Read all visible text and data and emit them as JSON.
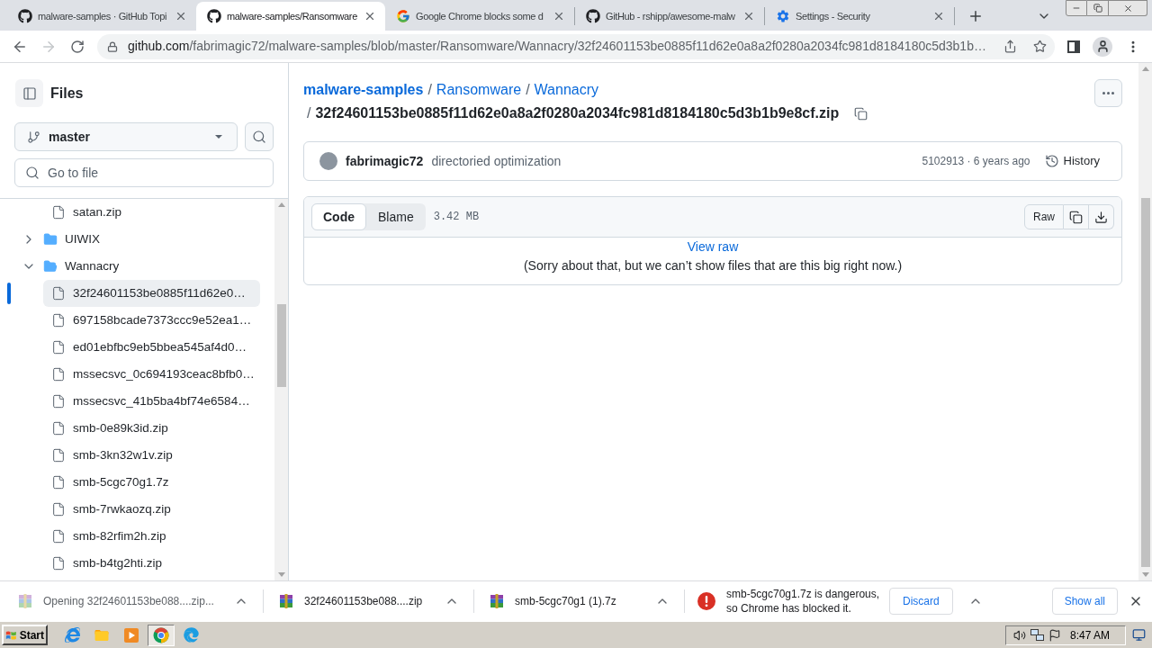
{
  "browser": {
    "tabs": [
      {
        "kind": "github",
        "title": "malware-samples · GitHub Topi",
        "selected": false
      },
      {
        "kind": "github",
        "title": "malware-samples/Ransomware",
        "selected": true
      },
      {
        "kind": "google",
        "title": "Google Chrome blocks some d",
        "selected": false
      },
      {
        "kind": "github",
        "title": "GitHub - rshipp/awesome-malw",
        "selected": false
      },
      {
        "kind": "settings",
        "title": "Settings - Security",
        "selected": false
      }
    ],
    "nav_buttons": [
      {
        "kind": "back",
        "disabled": false
      },
      {
        "kind": "forward",
        "disabled": true
      },
      {
        "kind": "reload",
        "disabled": false
      }
    ],
    "address_bar": {
      "host": "github.com",
      "path": "/fabrimagic72/malware-samples/blob/master/Ransomware/Wannacry/32f24601153be0885f11d62e0a8a2f0280a2034fc981d8184180c5d3b1b…"
    }
  },
  "sidebar": {
    "title": "Files",
    "branch": "master",
    "file_search": {
      "placeholder": "Go to file"
    },
    "tree": [
      {
        "kind": "continuation",
        "children": [
          {
            "kind": "file",
            "name": "satan.zip",
            "selected": false
          }
        ]
      },
      {
        "kind": "folder",
        "name": "UIWIX",
        "expanded": false,
        "selected": false
      },
      {
        "kind": "folder",
        "name": "Wannacry",
        "expanded": true,
        "selected": false,
        "children": [
          {
            "kind": "file",
            "name": "32f24601153be0885f11d62e0…",
            "selected": true
          },
          {
            "kind": "file",
            "name": "697158bcade7373ccc9e52ea1…",
            "selected": false
          },
          {
            "kind": "file",
            "name": "ed01ebfbc9eb5bbea545af4d0…",
            "selected": false
          },
          {
            "kind": "file",
            "name": "mssecsvc_0c694193ceac8bfb0…",
            "selected": false
          },
          {
            "kind": "file",
            "name": "mssecsvc_41b5ba4bf74e6584…",
            "selected": false
          },
          {
            "kind": "file",
            "name": "smb-0e89k3id.zip",
            "selected": false
          },
          {
            "kind": "file",
            "name": "smb-3kn32w1v.zip",
            "selected": false
          },
          {
            "kind": "file",
            "name": "smb-5cgc70g1.7z",
            "selected": false
          },
          {
            "kind": "file",
            "name": "smb-7rwkaozq.zip",
            "selected": false
          },
          {
            "kind": "file",
            "name": "smb-82rfim2h.zip",
            "selected": false
          },
          {
            "kind": "file",
            "name": "smb-b4tg2hti.zip",
            "selected": false
          }
        ]
      }
    ]
  },
  "file_view": {
    "breadcrumb": [
      {
        "kind": "repo",
        "text": "malware-samples"
      },
      {
        "kind": "separator",
        "text": "/"
      },
      {
        "kind": "folder",
        "text": "Ransomware"
      },
      {
        "kind": "separator",
        "text": "/"
      },
      {
        "kind": "folder",
        "text": "Wannacry"
      }
    ],
    "file_path": {
      "separator": "/",
      "name": "32f24601153be0885f11d62e0a8a2f0280a2034fc981d8184180c5d3b1b9e8cf.zip"
    },
    "commit": {
      "author": "fabrimagic72",
      "message": "directoried optimization",
      "sha_time": "5102913 · 6 years ago",
      "history": "History"
    },
    "file": {
      "view_tabs": [
        {
          "label": "Code",
          "selected": true
        },
        {
          "label": "Blame",
          "selected": false
        }
      ],
      "size": "3.42 MB",
      "raw_label": "Raw",
      "view_raw_link": "View raw",
      "notice": "(Sorry about that, but we can’t show files that are this big right now.)"
    }
  },
  "downloads": {
    "items": [
      {
        "kind": "opening",
        "label": "Opening 32f24601153be088....zip..."
      },
      {
        "kind": "archive",
        "label": "32f24601153be088....zip"
      },
      {
        "kind": "archive",
        "label": "smb-5cgc70g1 (1).7z"
      },
      {
        "kind": "blocked",
        "label": "smb-5cgc70g1.7z is dangerous, so Chrome has blocked it.",
        "action": "Discard"
      }
    ],
    "show_all": "Show all"
  },
  "taskbar": {
    "start": "Start",
    "quick_launch": [
      {
        "kind": "ie",
        "selected": false
      },
      {
        "kind": "explorer",
        "selected": false
      },
      {
        "kind": "media",
        "selected": false
      },
      {
        "kind": "chrome",
        "selected": true
      },
      {
        "kind": "edge",
        "selected": false
      }
    ],
    "clock": "8:47 AM"
  }
}
